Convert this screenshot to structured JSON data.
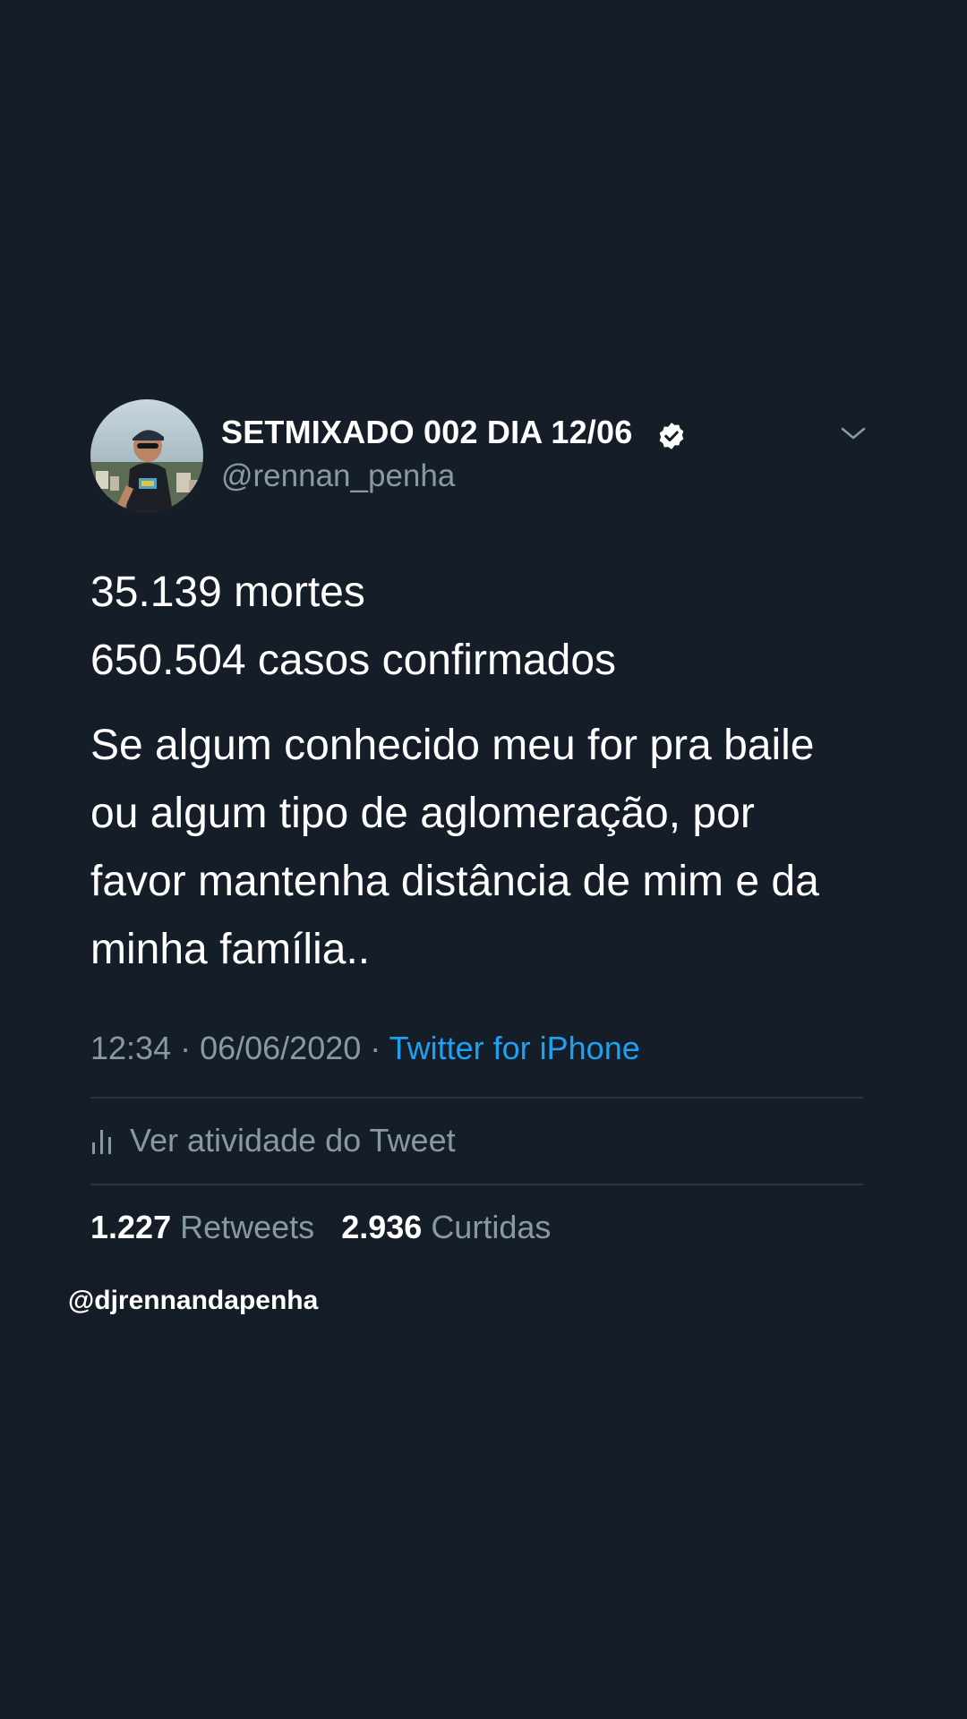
{
  "tweet": {
    "display_name": "SETMIXADO 002 DIA 12/06",
    "handle": "@rennan_penha",
    "verified_icon": "verified-badge-icon",
    "menu_icon": "chevron-down-icon",
    "lines": [
      "35.139 mortes",
      "650.504 casos confirmados",
      "Se algum conhecido meu for pra baile",
      "ou algum tipo de aglomeração, por",
      "favor mantenha distância de mim e da",
      "minha família.."
    ],
    "time": "12:34",
    "separator": " · ",
    "date": "06/06/2020",
    "source": "Twitter for iPhone",
    "activity_label": "Ver atividade do Tweet",
    "activity_icon": "bar-chart-icon",
    "retweets_count": "1.227",
    "retweets_label": "Retweets",
    "likes_count": "2.936",
    "likes_label": "Curtidas"
  },
  "watermark": "@djrennandapenha",
  "colors": {
    "background": "#141c27",
    "text_primary": "#ffffff",
    "text_secondary": "#8899a6",
    "link": "#1da1f2",
    "divider": "#2b3440"
  }
}
